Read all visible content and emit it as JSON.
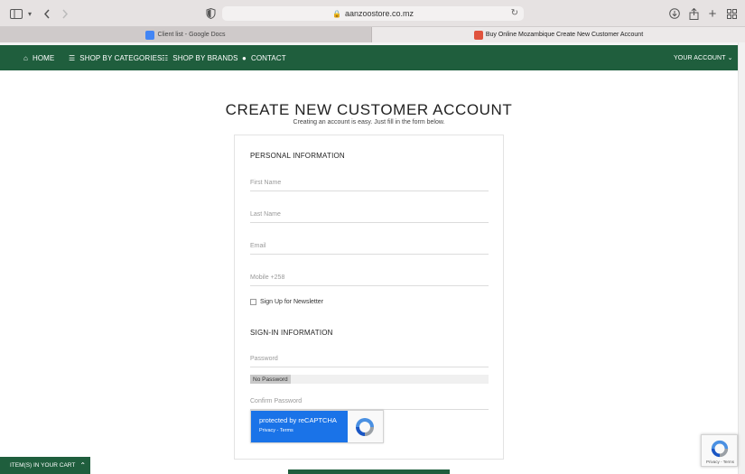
{
  "browser": {
    "url": "aanzoostore.co.mz",
    "tabs": [
      {
        "label": "Client list - Google Docs"
      },
      {
        "label": "Buy Online Mozambique Create New Customer Account"
      }
    ]
  },
  "nav": {
    "home": "HOME",
    "categories": "SHOP BY CATEGORIES",
    "brands": "SHOP BY BRANDS",
    "contact": "CONTACT",
    "account": "YOUR ACCOUNT"
  },
  "page": {
    "title": "CREATE NEW CUSTOMER ACCOUNT",
    "subtitle": "Creating an account is easy. Just fill in the form below."
  },
  "form": {
    "personal_heading": "PERSONAL INFORMATION",
    "first_name": "First Name",
    "last_name": "Last Name",
    "email": "Email",
    "mobile": "Mobile +258",
    "newsletter": "Sign Up for Newsletter",
    "signin_heading": "SIGN-IN INFORMATION",
    "password": "Password",
    "strength": "No Password",
    "confirm_password": "Confirm Password"
  },
  "recaptcha": {
    "protected": "protected by reCAPTCHA",
    "links": "Privacy - Terms",
    "badge_links": "Privacy - Terms"
  },
  "cart": {
    "label": "ITEM(S) IN YOUR CART"
  },
  "colors": {
    "brand_green": "#1f5e3d",
    "recaptcha_blue": "#1a73e8"
  }
}
